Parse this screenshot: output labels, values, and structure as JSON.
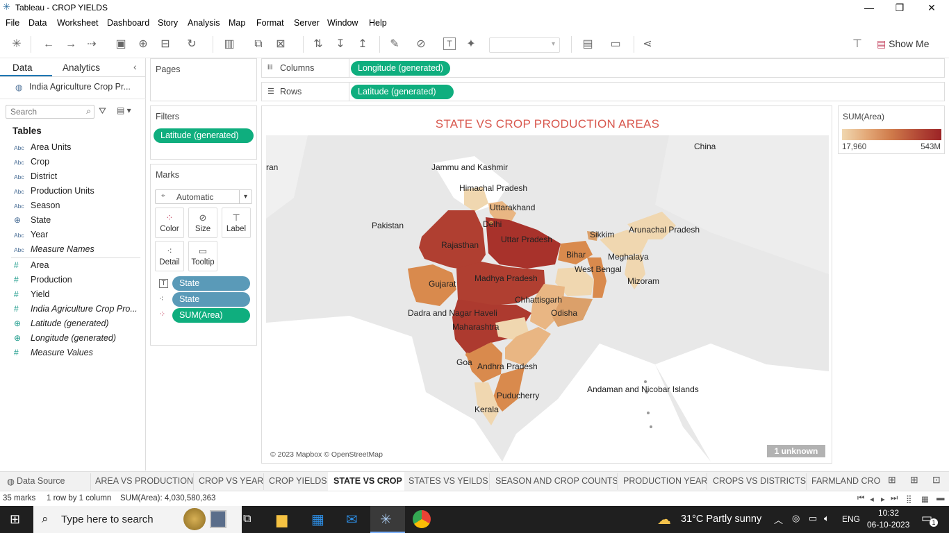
{
  "window": {
    "title": "Tableau - CROP YIELDS",
    "minimize": "—",
    "restore": "❐",
    "close": "✕"
  },
  "menu": [
    "File",
    "Data",
    "Worksheet",
    "Dashboard",
    "Story",
    "Analysis",
    "Map",
    "Format",
    "Server",
    "Window",
    "Help"
  ],
  "toolbar": {
    "show_me": "Show Me"
  },
  "left_pane": {
    "tab_data": "Data",
    "tab_analytics": "Analytics",
    "datasource": "India Agriculture Crop Pr...",
    "search_placeholder": "Search",
    "tables_heading": "Tables",
    "dimensions": [
      {
        "type": "Abc",
        "label": "Area Units"
      },
      {
        "type": "Abc",
        "label": "Crop"
      },
      {
        "type": "Abc",
        "label": "District"
      },
      {
        "type": "Abc",
        "label": "Production Units"
      },
      {
        "type": "Abc",
        "label": "Season"
      },
      {
        "type": "globe",
        "label": "State"
      },
      {
        "type": "Abc",
        "label": "Year"
      },
      {
        "type": "Abc",
        "label": "Measure Names"
      }
    ],
    "measures": [
      {
        "type": "#",
        "label": "Area"
      },
      {
        "type": "#",
        "label": "Production"
      },
      {
        "type": "#",
        "label": "Yield"
      },
      {
        "type": "#",
        "label": "India Agriculture Crop Pro..."
      },
      {
        "type": "globe",
        "label": "Latitude (generated)"
      },
      {
        "type": "globe",
        "label": "Longitude (generated)"
      },
      {
        "type": "#",
        "label": "Measure Values"
      }
    ]
  },
  "pages": {
    "label": "Pages"
  },
  "filters": {
    "label": "Filters",
    "pill": "Latitude (generated)"
  },
  "marks": {
    "label": "Marks",
    "type": "Automatic",
    "buttons": [
      "Color",
      "Size",
      "Label",
      "Detail",
      "Tooltip"
    ],
    "pills": [
      "State",
      "State",
      "SUM(Area)"
    ]
  },
  "columns": {
    "label": "Columns",
    "pill": "Longitude (generated)"
  },
  "rows": {
    "label": "Rows",
    "pill": "Latitude (generated)"
  },
  "viz": {
    "title": "STATE VS CROP PRODUCTION AREAS",
    "copyright": "© 2023 Mapbox © OpenStreetMap",
    "unknown": "1 unknown",
    "country_labels": [
      "China",
      "Pakistan",
      "ran"
    ],
    "state_labels": [
      "Jammu and Kashmir",
      "Himachal Pradesh",
      "Uttarakhand",
      "Delhi",
      "Rajasthan",
      "Uttar Pradesh",
      "Sikkim",
      "Arunachal Pradesh",
      "Bihar",
      "Meghalaya",
      "West Bengal",
      "Mizoram",
      "Gujarat",
      "Madhya Pradesh",
      "Chhattisgarh",
      "Dadra and Nagar Haveli",
      "Odisha",
      "Maharashtra",
      "Goa",
      "Andhra Pradesh",
      "Andaman and Nicobar Islands",
      "Puducherry",
      "Kerala"
    ],
    "colors": {
      "low": "#f0d7b0",
      "mid": "#d98a4d",
      "high": "#a8322b",
      "title": "#d8574d"
    }
  },
  "legend": {
    "title": "SUM(Area)",
    "min": "17,960",
    "max": "543M"
  },
  "sheet_tabs": {
    "data_source": "Data Source",
    "tabs": [
      "AREA VS PRODUCTION",
      "CROP VS YEAR",
      "CROP YIELDS",
      "STATE VS CROP",
      "STATES VS YEILDS",
      "SEASON AND CROP COUNTS",
      "PRODUCTION YEAR",
      "CROPS VS DISTRICTS",
      "FARMLAND CROP"
    ],
    "active": "STATE VS CROP"
  },
  "status": {
    "marks": "35 marks",
    "rowcol": "1 row by 1 column",
    "sum": "SUM(Area): 4,030,580,363"
  },
  "taskbar": {
    "search_placeholder": "Type here to search",
    "weather": "31°C  Partly sunny",
    "lang": "ENG",
    "time": "10:32",
    "date": "06-10-2023",
    "notifications": "1"
  }
}
